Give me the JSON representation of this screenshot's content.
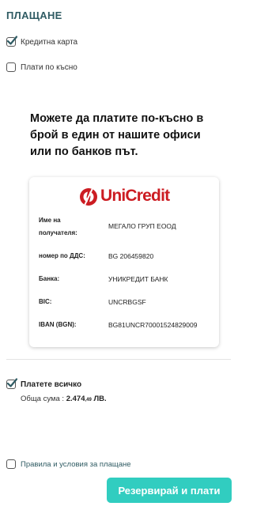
{
  "section_title": "ПЛАЩАНЕ",
  "options": {
    "credit_card_label": "Кредитна карта",
    "credit_card_checked": true,
    "pay_later_label": "Плати по късно",
    "pay_later_checked": false
  },
  "bank_info": {
    "headline": "Можете да платите по-късно в брой в един от нашите офиси или по банков път.",
    "bank_logo_text": "UniCredit",
    "rows": [
      {
        "label": "Име на получателя:",
        "value": "МЕГАЛО ГРУП ЕООД"
      },
      {
        "label": "номер по ДДС:",
        "value": "BG 206459820"
      },
      {
        "label": "Банка:",
        "value": "УНИКРЕДИТ БАНК"
      },
      {
        "label": "BIC:",
        "value": "UNCRBGSF"
      },
      {
        "label": "IBAN (BGN):",
        "value": "BG81UNCR70001524829009"
      }
    ]
  },
  "pay_all": {
    "label": "Платете всичко",
    "checked": true,
    "total_label": "Обща сума :",
    "total_main": "2.474",
    "total_decimals": ",49",
    "currency": "ЛВ."
  },
  "terms_label": "Правила и условия за плащане",
  "terms_checked": false,
  "submit_label": "Резервирай и плати",
  "colors": {
    "accent": "#31cdc0",
    "title": "#2f5b63",
    "brand_red": "#cc1c22"
  }
}
